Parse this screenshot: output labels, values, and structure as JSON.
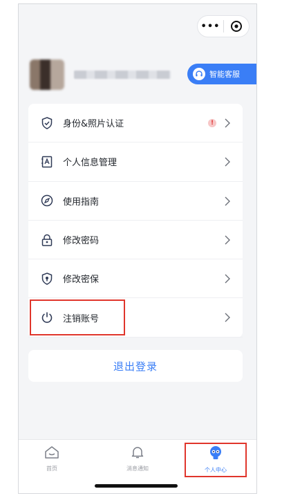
{
  "header": {
    "capsule_more": "•••",
    "cs_button_label": "智能客服"
  },
  "menu": {
    "items": [
      {
        "label": "身份&照片认证",
        "icon": "shield-check-icon",
        "badge": "!"
      },
      {
        "label": "个人信息管理",
        "icon": "id-card-icon"
      },
      {
        "label": "使用指南",
        "icon": "compass-icon"
      },
      {
        "label": "修改密码",
        "icon": "lock-icon"
      },
      {
        "label": "修改密保",
        "icon": "shield-icon"
      },
      {
        "label": "注销账号",
        "icon": "power-icon"
      }
    ]
  },
  "logout_label": "退出登录",
  "tabbar": {
    "tabs": [
      {
        "label": "首页",
        "icon": "home-icon"
      },
      {
        "label": "消息通知",
        "icon": "bell-icon"
      },
      {
        "label": "个人中心",
        "icon": "robot-icon",
        "active": true
      }
    ]
  },
  "colors": {
    "accent": "#3a7ef6",
    "highlight": "#e0352b",
    "background": "#f4f5f7"
  }
}
